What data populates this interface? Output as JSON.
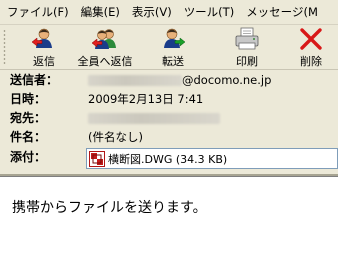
{
  "menu": {
    "items": [
      "ファイル(F)",
      "編集(E)",
      "表示(V)",
      "ツール(T)",
      "メッセージ(M"
    ]
  },
  "toolbar": {
    "reply": "返信",
    "reply_all": "全員へ返信",
    "forward": "転送",
    "print": "印刷",
    "delete": "削除"
  },
  "header": {
    "from_label": "送信者：",
    "from_value": "@docomo.ne.jp",
    "date_label": "日時：",
    "date_value": "2009年2月13日 7:41",
    "to_label": "宛先：",
    "subject_label": "件名：",
    "subject_value": "(件名なし)",
    "attach_label": "添付：",
    "attachment_name": "横断図.DWG (34.3 KB)"
  },
  "body": {
    "text": "携帯からファイルを送ります。"
  }
}
